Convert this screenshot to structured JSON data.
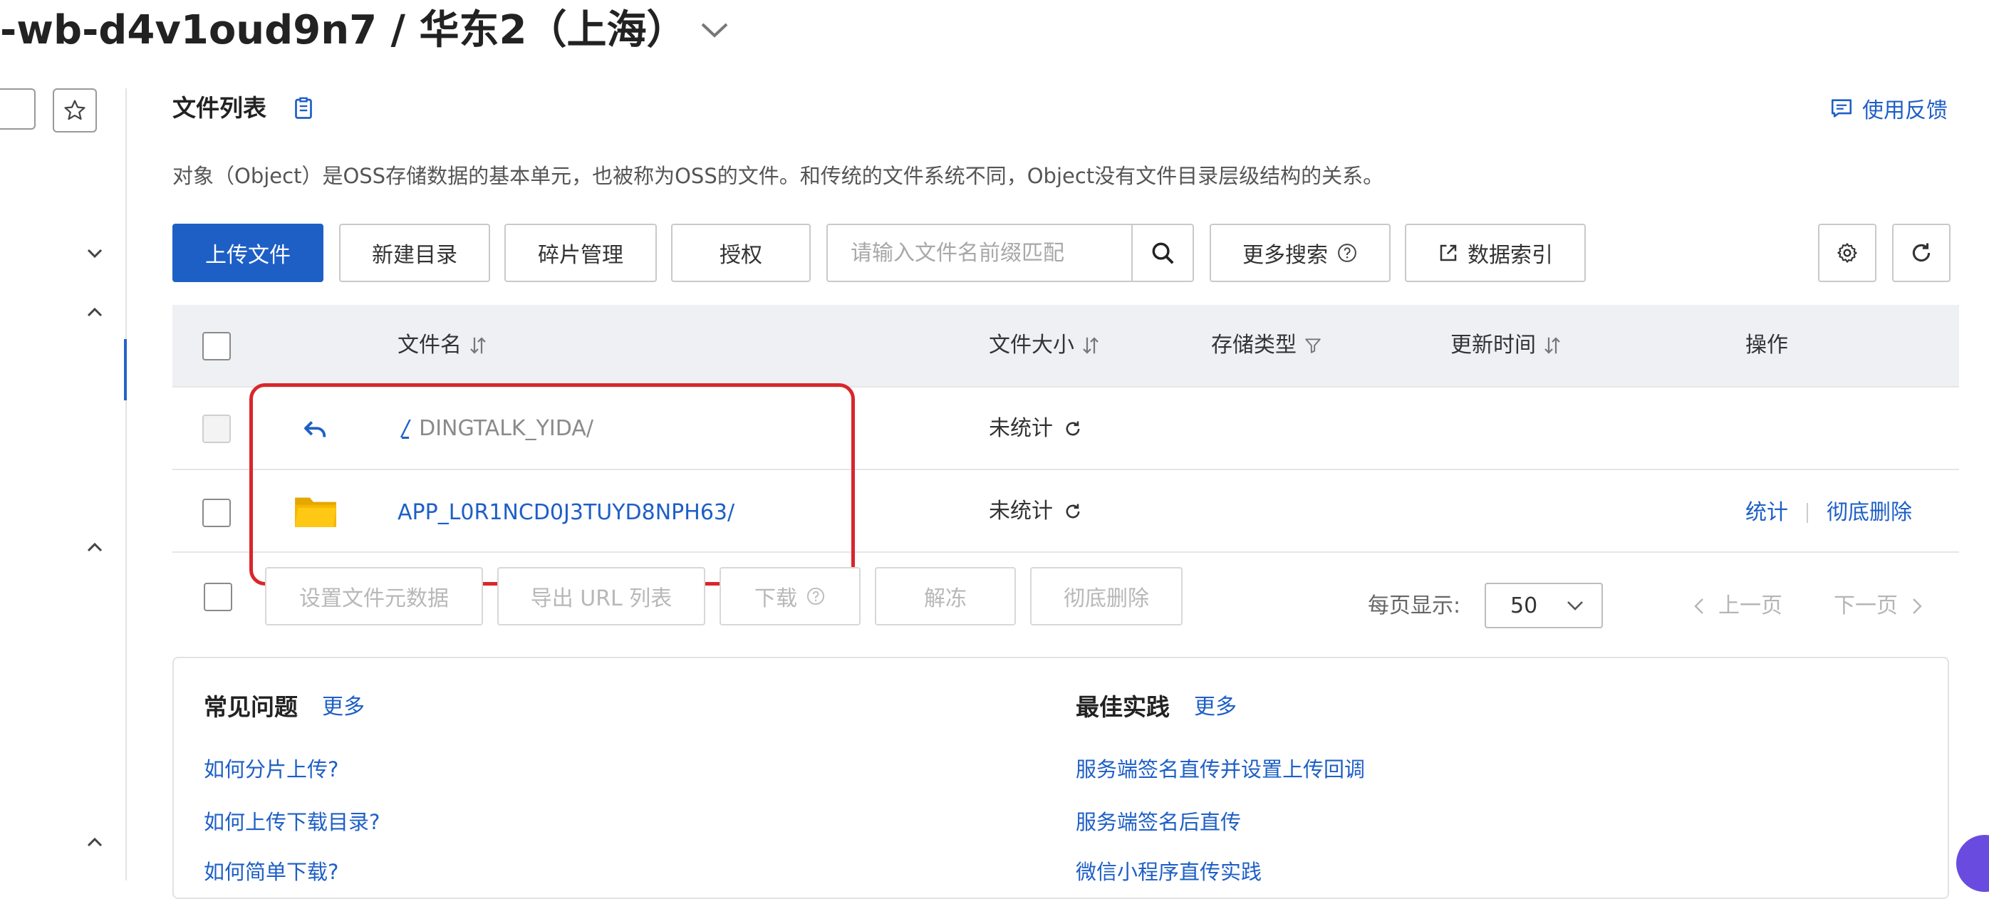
{
  "header": {
    "bucket_title": "-wb-d4v1oud9n7 / 华东2（上海）"
  },
  "section": {
    "title": "文件列表",
    "feedback_label": "使用反馈",
    "description": "对象（Object）是OSS存储数据的基本单元，也被称为OSS的文件。和传统的文件系统不同，Object没有文件目录层级结构的关系。"
  },
  "toolbar": {
    "upload_label": "上传文件",
    "new_dir_label": "新建目录",
    "fragments_label": "碎片管理",
    "authorize_label": "授权",
    "search_placeholder": "请输入文件名前缀匹配",
    "more_search_label": "更多搜索",
    "data_index_label": "数据索引"
  },
  "table": {
    "columns": {
      "name": "文件名",
      "size": "文件大小",
      "storage_type": "存储类型",
      "updated": "更新时间",
      "actions": "操作"
    },
    "rows": [
      {
        "slash": "/",
        "path": "DINGTALK_YIDA/",
        "size": "未统计"
      },
      {
        "name": "APP_L0R1NCD0J3TUYD8NPH63/",
        "size": "未统计",
        "action_stat": "统计",
        "action_delete": "彻底删除"
      }
    ]
  },
  "bulk_actions": {
    "set_metadata": "设置文件元数据",
    "export_urls": "导出 URL 列表",
    "download": "下载",
    "unfreeze": "解冻",
    "delete": "彻底删除"
  },
  "pagination": {
    "per_page_label": "每页显示:",
    "per_page_value": "50",
    "prev_label": "上一页",
    "next_label": "下一页"
  },
  "faq": {
    "title": "常见问题",
    "more": "更多",
    "items": [
      "如何分片上传?",
      "如何上传下载目录?",
      "如何简单下载?"
    ]
  },
  "best_practice": {
    "title": "最佳实践",
    "more": "更多",
    "items": [
      "服务端签名直传并设置上传回调",
      "服务端签名后直传",
      "微信小程序直传实践"
    ]
  },
  "colors": {
    "brand_blue": "#1e5fc6",
    "highlight_red": "#d9262b",
    "folder_yellow": "#f5b800"
  }
}
